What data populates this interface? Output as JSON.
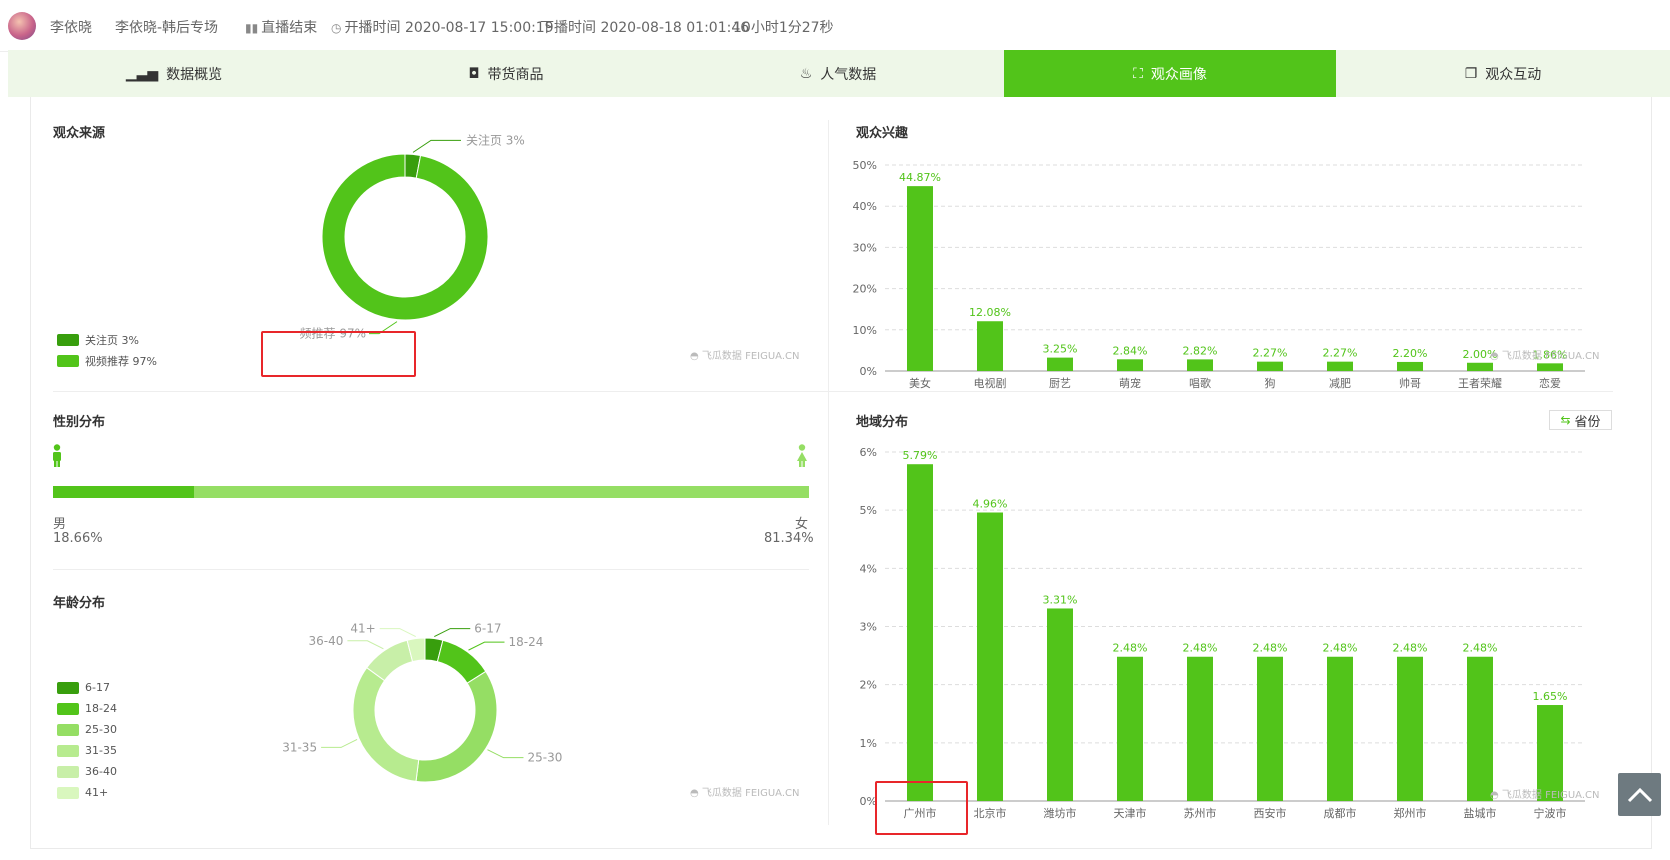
{
  "header": {
    "anchor_name": "李依晓",
    "room_title": "李依晓-韩后专场",
    "status": "直播结束",
    "start_label": "开播时间",
    "start_time": "2020-08-17 15:00:19",
    "end_label": "下播时间",
    "end_time": "2020-08-18 01:01:46",
    "duration": "10小时1分27秒"
  },
  "tabs": [
    {
      "label": "数据概览",
      "icon": "bar-chart-icon"
    },
    {
      "label": "带货商品",
      "icon": "shopping-bag-icon"
    },
    {
      "label": "人气数据",
      "icon": "flame-icon"
    },
    {
      "label": "观众画像",
      "icon": "portrait-icon",
      "active": true
    },
    {
      "label": "观众互动",
      "icon": "interaction-icon"
    }
  ],
  "sections": {
    "source": "观众来源",
    "interest": "观众兴趣",
    "gender": "性别分布",
    "region": "地域分布",
    "age": "年龄分布"
  },
  "gender": {
    "male_label": "男",
    "male_value": "18.66%",
    "male_fraction": 0.1866,
    "female_label": "女",
    "female_value": "81.34%"
  },
  "region_toggle": "省份",
  "watermark": "飞瓜数据",
  "watermark_sub": "FEIGUA.CN",
  "colors": {
    "primary": "#52c41a",
    "dark": "#389e0d",
    "tab_bg": "#eef7e8"
  },
  "chart_data": [
    {
      "id": "source",
      "type": "pie",
      "labels": [
        "关注页",
        "视频推荐"
      ],
      "values": [
        3,
        97
      ],
      "label_text": [
        "关注页 3%",
        "视频推荐 97%"
      ],
      "colors": [
        "#389e0d",
        "#52c41a"
      ],
      "legend": "bottom-left"
    },
    {
      "id": "interest",
      "type": "bar",
      "categories": [
        "美女",
        "电视剧",
        "厨艺",
        "萌宠",
        "唱歌",
        "狗",
        "减肥",
        "帅哥",
        "王者荣耀",
        "恋爱"
      ],
      "values": [
        44.87,
        12.08,
        3.25,
        2.84,
        2.82,
        2.27,
        2.27,
        2.2,
        2.0,
        1.86
      ],
      "data_labels": [
        "44.87%",
        "12.08%",
        "3.25%",
        "2.84%",
        "2.82%",
        "2.27%",
        "2.27%",
        "2.20%",
        "2.00%",
        "1.86%"
      ],
      "yticks": [
        "0%",
        "10%",
        "20%",
        "30%",
        "40%",
        "50%"
      ],
      "ylim": [
        0,
        50
      ],
      "grid": true
    },
    {
      "id": "region",
      "type": "bar",
      "categories": [
        "广州市",
        "北京市",
        "潍坊市",
        "天津市",
        "苏州市",
        "西安市",
        "成都市",
        "郑州市",
        "盐城市",
        "宁波市"
      ],
      "values": [
        5.79,
        4.96,
        3.31,
        2.48,
        2.48,
        2.48,
        2.48,
        2.48,
        2.48,
        1.65
      ],
      "data_labels": [
        "5.79%",
        "4.96%",
        "3.31%",
        "2.48%",
        "2.48%",
        "2.48%",
        "2.48%",
        "2.48%",
        "2.48%",
        "1.65%"
      ],
      "yticks": [
        "0%",
        "1%",
        "2%",
        "3%",
        "4%",
        "5%",
        "6%"
      ],
      "ylim": [
        0,
        6
      ],
      "grid": true
    },
    {
      "id": "age",
      "type": "pie",
      "labels": [
        "6-17",
        "18-24",
        "25-30",
        "31-35",
        "36-40",
        "41+"
      ],
      "values": [
        4,
        12,
        36,
        33,
        11,
        4
      ],
      "colors": [
        "#389e0d",
        "#52c41a",
        "#95de64",
        "#b7eb8f",
        "#c8efa8",
        "#d9f7be"
      ],
      "legend": "left"
    }
  ]
}
